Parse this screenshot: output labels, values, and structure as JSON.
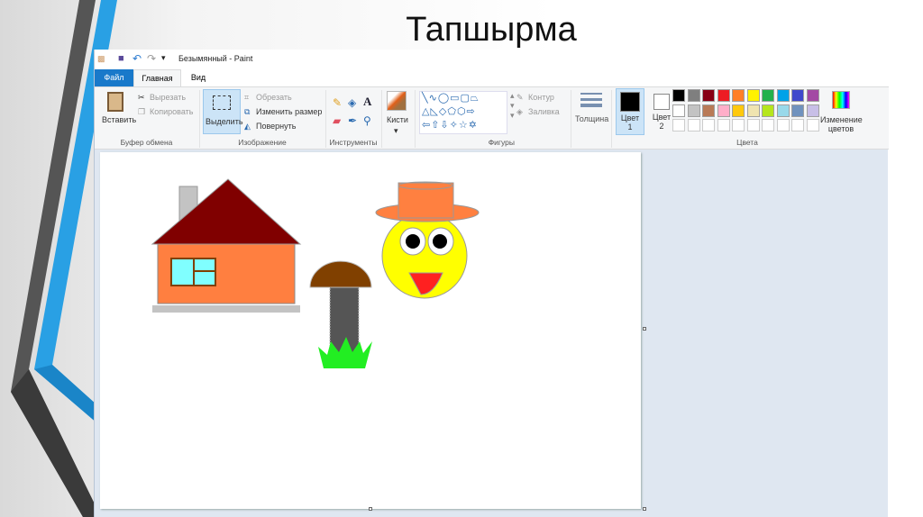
{
  "slide": {
    "title": "Тапшырма"
  },
  "paint": {
    "window_title": "Безымянный - Paint",
    "tabs": [
      "Файл",
      "Главная",
      "Вид"
    ],
    "clipboard": {
      "paste": "Вставить",
      "cut": "Вырезать",
      "copy": "Копировать",
      "group": "Буфер обмена"
    },
    "image": {
      "select": "Выделить",
      "crop": "Обрезать",
      "resize": "Изменить размер",
      "rotate": "Повернуть",
      "group": "Изображение"
    },
    "tools": {
      "group": "Инструменты"
    },
    "brushes": {
      "label": "Кисти"
    },
    "shapes": {
      "outline": "Контур",
      "fill": "Заливка",
      "group": "Фигуры"
    },
    "size": {
      "label": "Толщина"
    },
    "color1": {
      "label": "Цвет",
      "num": "1",
      "value": "#000000"
    },
    "color2": {
      "label": "Цвет",
      "num": "2",
      "value": "#ffffff"
    },
    "colors_group": "Цвета",
    "edit_colors": "Изменение цветов",
    "palette": [
      [
        "#000000",
        "#7f7f7f",
        "#880015",
        "#ed1c24",
        "#ff7f27",
        "#fff200",
        "#22b14c",
        "#00a2e8",
        "#3f48cc",
        "#a349a4"
      ],
      [
        "#ffffff",
        "#c3c3c3",
        "#b97a57",
        "#ffaec9",
        "#ffc90e",
        "#efe4b0",
        "#b5e61d",
        "#99d9ea",
        "#7092be",
        "#c8bfe7"
      ]
    ]
  }
}
